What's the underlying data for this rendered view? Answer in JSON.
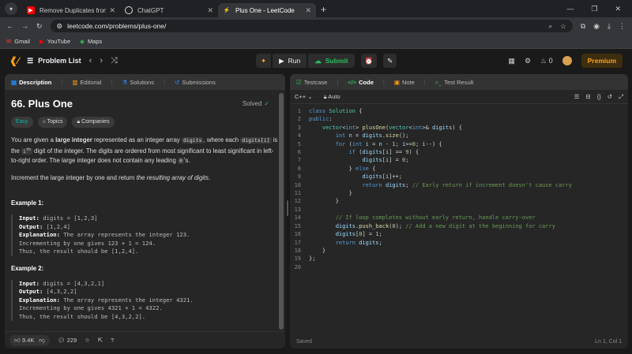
{
  "browser": {
    "tabs": [
      {
        "title": "Remove Duplicates from Sorted",
        "favicon": "youtube-icon",
        "color": "#ff0000",
        "active": false
      },
      {
        "title": "ChatGPT",
        "favicon": "chatgpt-icon",
        "color": "#ffffff",
        "active": false
      },
      {
        "title": "Plus One - LeetCode",
        "favicon": "leetcode-icon",
        "color": "#ffa116",
        "active": true
      }
    ],
    "url": "leetcode.com/problems/plus-one/",
    "bookmarks": [
      "Gmail",
      "YouTube",
      "Maps"
    ]
  },
  "nav": {
    "problem_list": "Problem List",
    "run": "Run",
    "submit": "Submit",
    "streak": "0",
    "premium": "Premium"
  },
  "left_tabs": [
    "Description",
    "Editorial",
    "Solutions",
    "Submissions"
  ],
  "problem": {
    "title": "66. Plus One",
    "status": "Solved",
    "difficulty": "Easy",
    "tags": [
      "Topics",
      "Companies"
    ],
    "p1_a": "You are given a ",
    "p1_b": "large integer",
    "p1_c": " represented as an integer array ",
    "p1_code1": "digits",
    "p1_d": ", where each ",
    "p1_code2": "digits[i]",
    "p1_e": " is the ",
    "p1_sup": "i",
    "p1_th": "th",
    "p1_f": " digit of the integer. The digits are ordered from most significant to least significant in left-to-right order. The large integer does not contain any leading ",
    "p1_code3": "0",
    "p1_g": "'s.",
    "p2_a": "Increment the large integer by one and return ",
    "p2_b": "the resulting array of digits",
    "p2_c": ".",
    "examples": [
      {
        "title": "Example 1:",
        "input": "digits = [1,2,3]",
        "output": "[1,2,4]",
        "expl": "The array represents the integer 123.",
        "l2": "Incrementing by one gives 123 + 1 = 124.",
        "l3": "Thus, the result should be [1,2,4]."
      },
      {
        "title": "Example 2:",
        "input": "digits = [4,3,2,1]",
        "output": "[4,3,2,2]",
        "expl": "The array represents the integer 4321.",
        "l2": "Incrementing by one gives 4321 + 1 = 4322.",
        "l3": "Thus, the result should be [4,3,2,2]."
      }
    ],
    "labels": {
      "input": "Input:",
      "output": "Output:",
      "explanation": "Explanation:"
    },
    "likes": "9.4K",
    "comments": "229"
  },
  "right_tabs": [
    "Testcase",
    "Code",
    "Note",
    "Test Result"
  ],
  "editor": {
    "language": "C++",
    "mode": "Auto",
    "status": "Saved",
    "cursor": "Ln 1, Col 1"
  }
}
